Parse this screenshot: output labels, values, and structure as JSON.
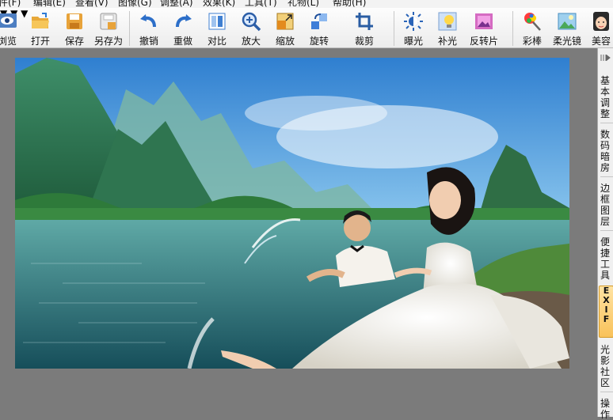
{
  "menu": [
    "件(F)",
    "编辑(E)",
    "查看(V)",
    "图像(G)",
    "调整(A)",
    "效果(K)",
    "工具(T)",
    "礼物(L)",
    "帮助(H)"
  ],
  "toolbar": {
    "browse": "浏览",
    "open": "打开",
    "save": "保存",
    "save_as": "另存为",
    "undo": "撤销",
    "redo": "重做",
    "compare": "对比",
    "zoom_in": "放大",
    "resize": "缩放",
    "rotate": "旋转",
    "crop": "裁剪",
    "exposure": "曝光",
    "fill_light": "补光",
    "invert": "反转片",
    "color_wand": "彩棒",
    "soft_lens": "柔光镜",
    "beauty": "美容"
  },
  "right_panel": {
    "tab_basic": "基本调整",
    "tab_darkroom": "数码暗房",
    "tab_border": "边框图层",
    "tab_tools": "便捷工具",
    "tab_exif": "EXIF",
    "tab_community": "光影社区",
    "tab_ops": "操作"
  },
  "colors": {
    "toolbar_bg": "#f3f3f3",
    "canvas_bg": "#7b7b7b",
    "exif_tab": "#f9c25a"
  }
}
